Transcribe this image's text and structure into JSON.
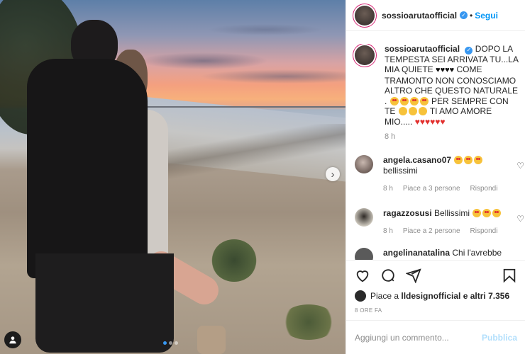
{
  "post": {
    "author": "sossioarutaofficial",
    "follow_label": "Segui",
    "separator": "•",
    "caption": "DOPO LA TEMPESTA SEI ARRIVATA TU...LA MIA QUIETE",
    "caption_middle": "COME TRAMONTO NON CONOSCIAMO ALTRO CHE QUESTO NATURALE .",
    "caption_per": "PER SEMPRE CON TE",
    "caption_end": "TI AMO AMORE MIO.....",
    "caption_time": "8 h"
  },
  "comments": [
    {
      "username": "angela.casano07",
      "text": "bellissimi",
      "time": "8 h",
      "likes": "Piace a 3 persone",
      "reply": "Rispondi"
    },
    {
      "username": "ragazzosusi",
      "text": "Bellissimi",
      "time": "8 h",
      "likes": "Piace a 2 persone",
      "reply": "Rispondi"
    },
    {
      "username": "angelinanatalina",
      "text": "Chi l'avrebbe"
    }
  ],
  "likes": {
    "prefix": "Piace a",
    "user": "lldesignofficial",
    "suffix": "e altri 7.356"
  },
  "post_time": "8 ORE FA",
  "add_comment": {
    "placeholder": "Aggiungi un commento...",
    "publish_label": "Pubblica"
  },
  "icons": {
    "like": "heart-icon",
    "comment": "comment-icon",
    "share": "share-icon",
    "save": "bookmark-icon",
    "next": "chevron-right-icon",
    "tag": "user-tag-icon"
  },
  "colors": {
    "accent": "#0095f6",
    "verified": "#3897f0",
    "publish_disabled": "#b2dffc"
  }
}
